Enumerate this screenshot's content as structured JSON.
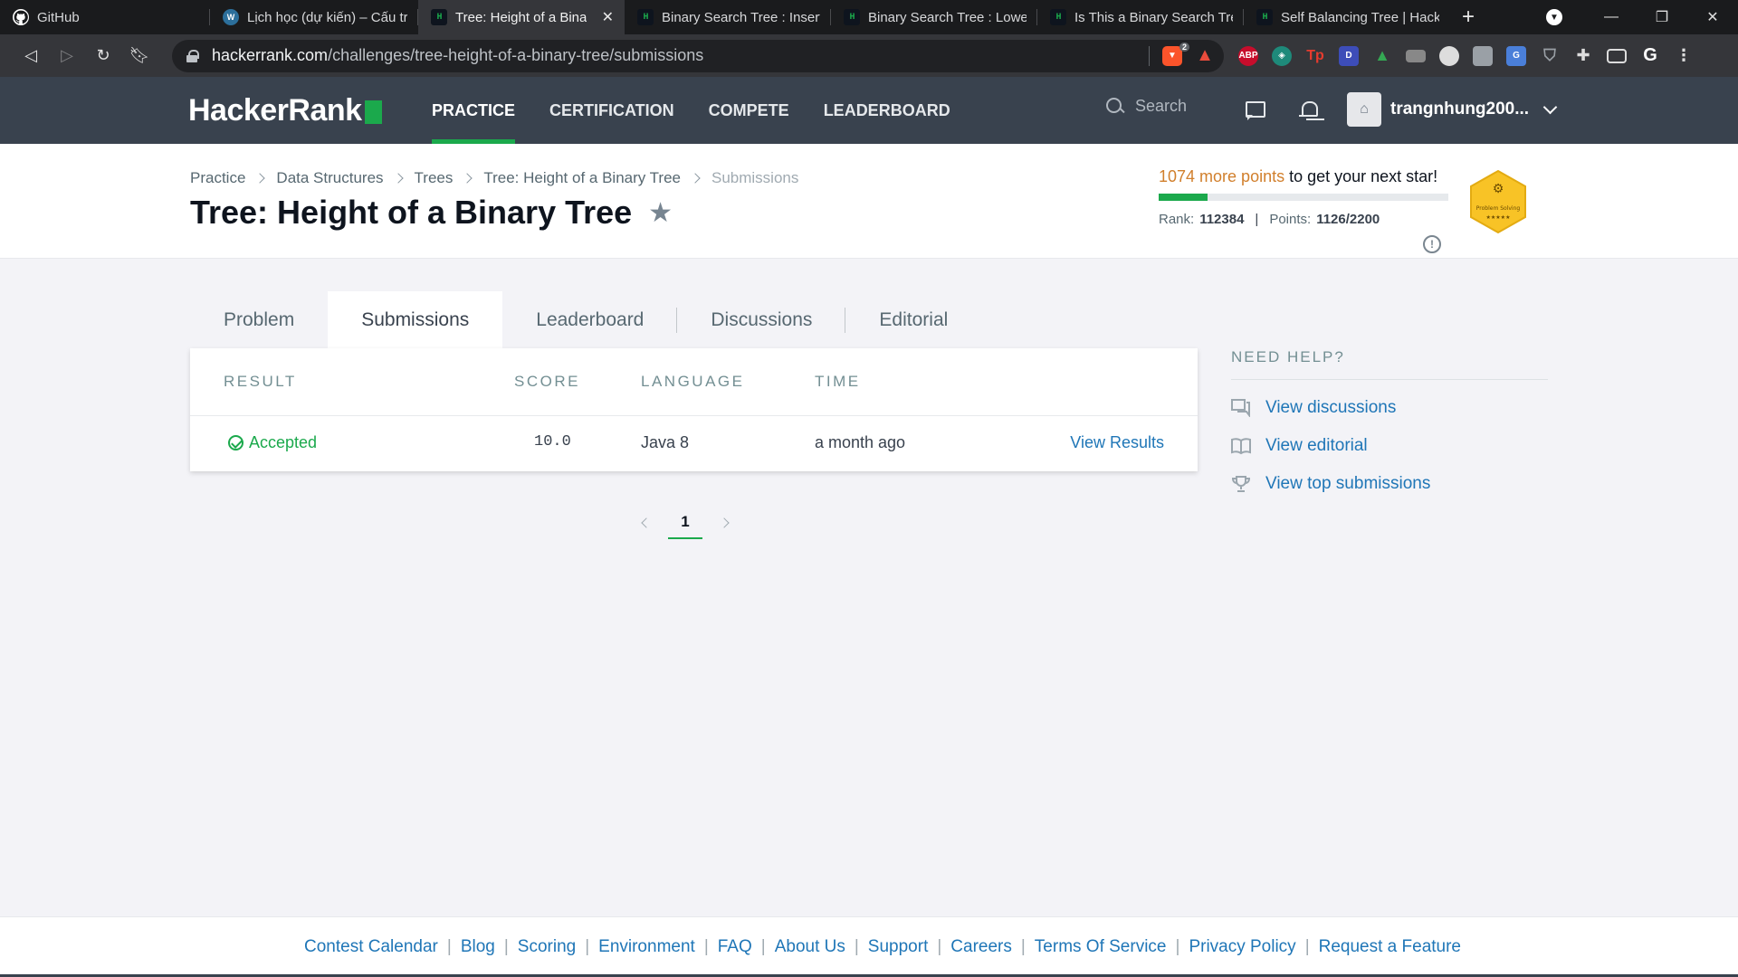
{
  "browser": {
    "tabs": [
      {
        "title": "GitHub",
        "favicon": "github-icon",
        "active": false
      },
      {
        "title": "Lịch học (dự kiến) – Cấu trú",
        "favicon": "wordpress-icon",
        "active": false
      },
      {
        "title": "Tree: Height of a Binary",
        "favicon": "hackerrank-icon",
        "active": true
      },
      {
        "title": "Binary Search Tree : Insertio",
        "favicon": "hackerrank-icon",
        "active": false
      },
      {
        "title": "Binary Search Tree : Lowest",
        "favicon": "hackerrank-icon",
        "active": false
      },
      {
        "title": "Is This a Binary Search Tree",
        "favicon": "hackerrank-icon",
        "active": false
      },
      {
        "title": "Self Balancing Tree | Hacker",
        "favicon": "hackerrank-icon",
        "active": false
      }
    ],
    "url_host": "hackerrank.com",
    "url_path": "/challenges/tree-height-of-a-binary-tree/submissions",
    "brave_count": "2",
    "extensions": [
      "ABP",
      "Tp",
      "D"
    ]
  },
  "header": {
    "logo": "HackerRank",
    "nav": [
      {
        "label": "PRACTICE",
        "active": true
      },
      {
        "label": "CERTIFICATION",
        "active": false
      },
      {
        "label": "COMPETE",
        "active": false
      },
      {
        "label": "LEADERBOARD",
        "active": false
      }
    ],
    "search_placeholder": "Search",
    "username": "trangnhung200...",
    "accent_color": "#1ba94c"
  },
  "breadcrumb": [
    "Practice",
    "Data Structures",
    "Trees",
    "Tree: Height of a Binary Tree",
    "Submissions"
  ],
  "title": "Tree: Height of a Binary Tree",
  "progress": {
    "more_points": "1074 more points",
    "suffix": " to get your next star!",
    "rank_label": "Rank:",
    "rank": "112384",
    "points_label": "Points:",
    "points": "1126/2200",
    "fill_fraction": 0.17,
    "badge_label": "Problem Solving",
    "badge_stars": "★★★★★"
  },
  "tabs": [
    {
      "label": "Problem",
      "active": false
    },
    {
      "label": "Submissions",
      "active": true
    },
    {
      "label": "Leaderboard",
      "active": false
    },
    {
      "label": "Discussions",
      "active": false
    },
    {
      "label": "Editorial",
      "active": false
    }
  ],
  "table": {
    "headers": [
      "RESULT",
      "SCORE",
      "LANGUAGE",
      "TIME"
    ],
    "rows": [
      {
        "result": "Accepted",
        "score": "10.0",
        "language": "Java 8",
        "time": "a month ago",
        "action": "View Results"
      }
    ]
  },
  "pagination": {
    "current": "1"
  },
  "help": {
    "title": "NEED HELP?",
    "items": [
      "View discussions",
      "View editorial",
      "View top submissions"
    ]
  },
  "footer": [
    "Contest Calendar",
    "Blog",
    "Scoring",
    "Environment",
    "FAQ",
    "About Us",
    "Support",
    "Careers",
    "Terms Of Service",
    "Privacy Policy",
    "Request a Feature"
  ]
}
